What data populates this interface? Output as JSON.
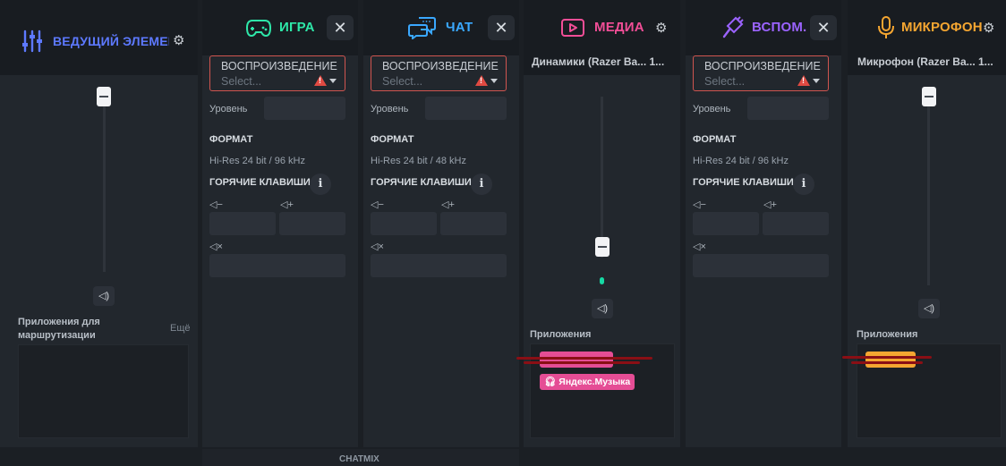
{
  "colors": {
    "master": "#5d79ff",
    "game": "#2ee8a9",
    "chat": "#3aa8ff",
    "media": "#f24e97",
    "aux": "#9b63ff",
    "mic": "#f5a631"
  },
  "master": {
    "title": "ВЕДУЩИЙ ЭЛЕМЕНТ",
    "apps_label": "Приложения для маршрутизации",
    "more_label": "Ещё"
  },
  "game": {
    "title": "ИГРА",
    "dd_label": "ВОСПРОИЗВЕДЕНИЕ",
    "dd_placeholder": "Select...",
    "level_label": "Уровень",
    "format_label": "ФОРМАТ",
    "format_value": "Hi-Res 24 bit / 96 kHz",
    "hotkeys_label": "ГОРЯЧИЕ КЛАВИШИ"
  },
  "chat": {
    "title": "ЧАТ",
    "dd_label": "ВОСПРОИЗВЕДЕНИЕ",
    "dd_placeholder": "Select...",
    "level_label": "Уровень",
    "format_label": "ФОРМАТ",
    "format_value": "Hi-Res 24 bit / 48 kHz",
    "hotkeys_label": "ГОРЯЧИЕ КЛАВИШИ"
  },
  "media": {
    "title": "МЕДИА",
    "device": "Динамики (Razer Ba... 1...",
    "apps_label": "Приложения",
    "apps": [
      "Яндекс.Музыка"
    ]
  },
  "aux": {
    "title": "ВСПОМ.",
    "dd_label": "ВОСПРОИЗВЕДЕНИЕ",
    "dd_placeholder": "Select...",
    "level_label": "Уровень",
    "format_label": "ФОРМАТ",
    "format_value": "Hi-Res 24 bit / 96 kHz",
    "hotkeys_label": "ГОРЯЧИЕ КЛАВИШИ"
  },
  "mic": {
    "title": "МИКРОФОН",
    "device": "Микрофон (Razer Ba... 1...",
    "apps_label": "Приложения"
  },
  "footer": {
    "chatmix": "CHATMIX"
  },
  "hotkey_icons": {
    "down": "◁−",
    "up": "◁+",
    "mute": "◁×"
  },
  "close_glyph": "✕",
  "gear_glyph": "⚙",
  "info_glyph": "i",
  "speaker_glyph": "◁)",
  "volumes": {
    "master": 1.0,
    "media": 0.18,
    "mic": 1.0
  }
}
